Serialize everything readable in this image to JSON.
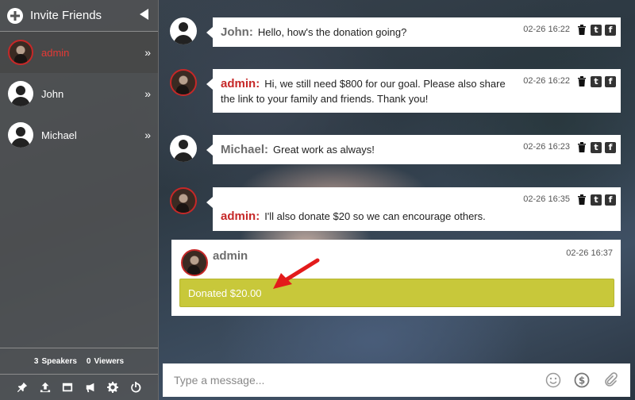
{
  "sidebar": {
    "title": "Invite Friends",
    "users": [
      {
        "name": "admin",
        "role": "admin"
      },
      {
        "name": "John",
        "role": "guest"
      },
      {
        "name": "Michael",
        "role": "guest"
      }
    ],
    "expand_glyph": "»",
    "speakers_count": "3",
    "speakers_label": "Speakers",
    "viewers_count": "0",
    "viewers_label": "Viewers",
    "toolbar_icons": [
      "pin-icon",
      "upload-icon",
      "window-icon",
      "megaphone-icon",
      "gear-icon",
      "power-icon"
    ]
  },
  "messages": [
    {
      "user": "John",
      "role": "guest",
      "text": "Hello, how's the donation going?",
      "time": "02-26 16:22"
    },
    {
      "user": "admin",
      "role": "admin",
      "text": "Hi, we still need $800 for our goal. Please also share the link to your family and friends. Thank you!",
      "time": "02-26 16:22"
    },
    {
      "user": "Michael",
      "role": "guest",
      "text": "Great work as always!",
      "time": "02-26 16:23"
    },
    {
      "user": "admin",
      "role": "admin",
      "text": "I'll also donate $20 so we can encourage others.",
      "time": "02-26 16:35"
    }
  ],
  "donation": {
    "user": "admin",
    "time": "02-26 16:37",
    "label": "Donated $20.00",
    "bar_color": "#c8c83a"
  },
  "social": {
    "twitter_glyph": "t",
    "facebook_glyph": "f"
  },
  "composer": {
    "placeholder": "Type a message...",
    "icons": [
      "emoji-icon",
      "dollar-icon",
      "attachment-icon"
    ]
  },
  "colors": {
    "admin": "#c62828",
    "guest": "#6d6d6d",
    "arrow": "#e31b1b"
  }
}
